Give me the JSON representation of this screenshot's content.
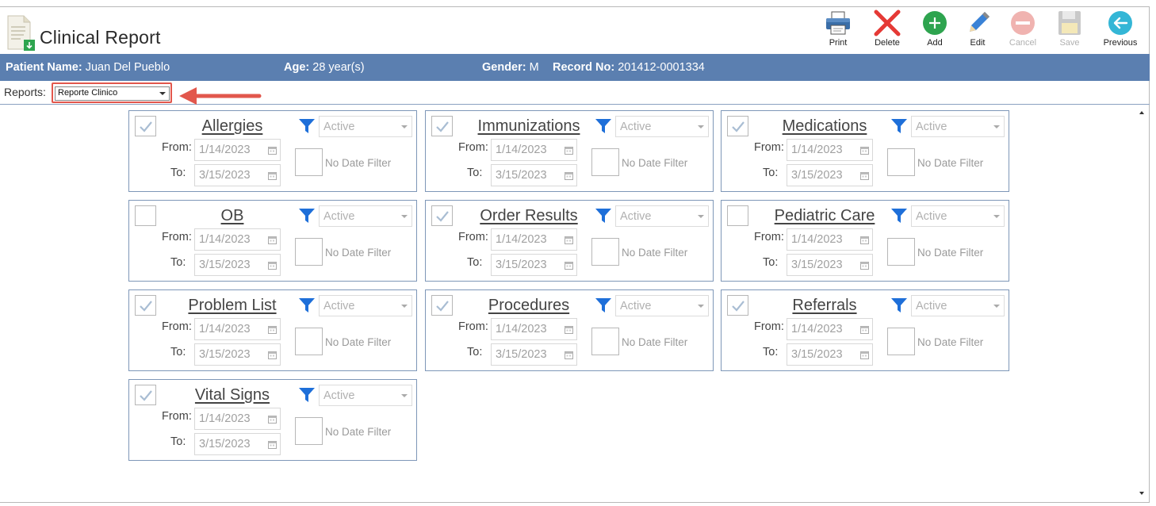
{
  "header": {
    "title": "Clinical Report",
    "toolbar": [
      {
        "id": "print",
        "label": "Print",
        "icon": "printer-icon",
        "enabled": true
      },
      {
        "id": "delete",
        "label": "Delete",
        "icon": "x-icon",
        "enabled": true
      },
      {
        "id": "add",
        "label": "Add",
        "icon": "plus-icon",
        "enabled": true
      },
      {
        "id": "edit",
        "label": "Edit",
        "icon": "pencil-icon",
        "enabled": true
      },
      {
        "id": "cancel",
        "label": "Cancel",
        "icon": "minus-circle-icon",
        "enabled": false
      },
      {
        "id": "save",
        "label": "Save",
        "icon": "floppy-icon",
        "enabled": false
      },
      {
        "id": "previous",
        "label": "Previous",
        "icon": "arrow-left-icon",
        "enabled": true
      }
    ]
  },
  "patient": {
    "name_label": "Patient Name:",
    "name": "Juan Del Pueblo",
    "age_label": "Age:",
    "age": "28 year(s)",
    "gender_label": "Gender:",
    "gender": "M",
    "record_label": "Record No:",
    "record": "201412-0001334"
  },
  "reports": {
    "label": "Reports:",
    "selected": "Reporte Clinico"
  },
  "colors": {
    "patient_bar": "#5b7fb0",
    "card_border": "#7e97b8",
    "highlight": "#e2574c",
    "funnel": "#1e6fd9"
  },
  "common": {
    "from_label": "From:",
    "to_label": "To:",
    "status_value": "Active",
    "no_date_filter": "No Date Filter"
  },
  "sections": [
    {
      "name": "Allergies",
      "checked": true,
      "from": "1/14/2023",
      "to": "3/15/2023"
    },
    {
      "name": "Immunizations",
      "checked": true,
      "from": "1/14/2023",
      "to": "3/15/2023"
    },
    {
      "name": "Medications",
      "checked": true,
      "from": "1/14/2023",
      "to": "3/15/2023"
    },
    {
      "name": "OB",
      "checked": false,
      "from": "1/14/2023",
      "to": "3/15/2023"
    },
    {
      "name": "Order Results",
      "checked": true,
      "from": "1/14/2023",
      "to": "3/15/2023"
    },
    {
      "name": "Pediatric Care",
      "checked": false,
      "from": "1/14/2023",
      "to": "3/15/2023"
    },
    {
      "name": "Problem List",
      "checked": true,
      "from": "1/14/2023",
      "to": "3/15/2023"
    },
    {
      "name": "Procedures",
      "checked": true,
      "from": "1/14/2023",
      "to": "3/15/2023"
    },
    {
      "name": "Referrals",
      "checked": true,
      "from": "1/14/2023",
      "to": "3/15/2023"
    },
    {
      "name": "Vital Signs",
      "checked": true,
      "from": "1/14/2023",
      "to": "3/15/2023"
    }
  ]
}
